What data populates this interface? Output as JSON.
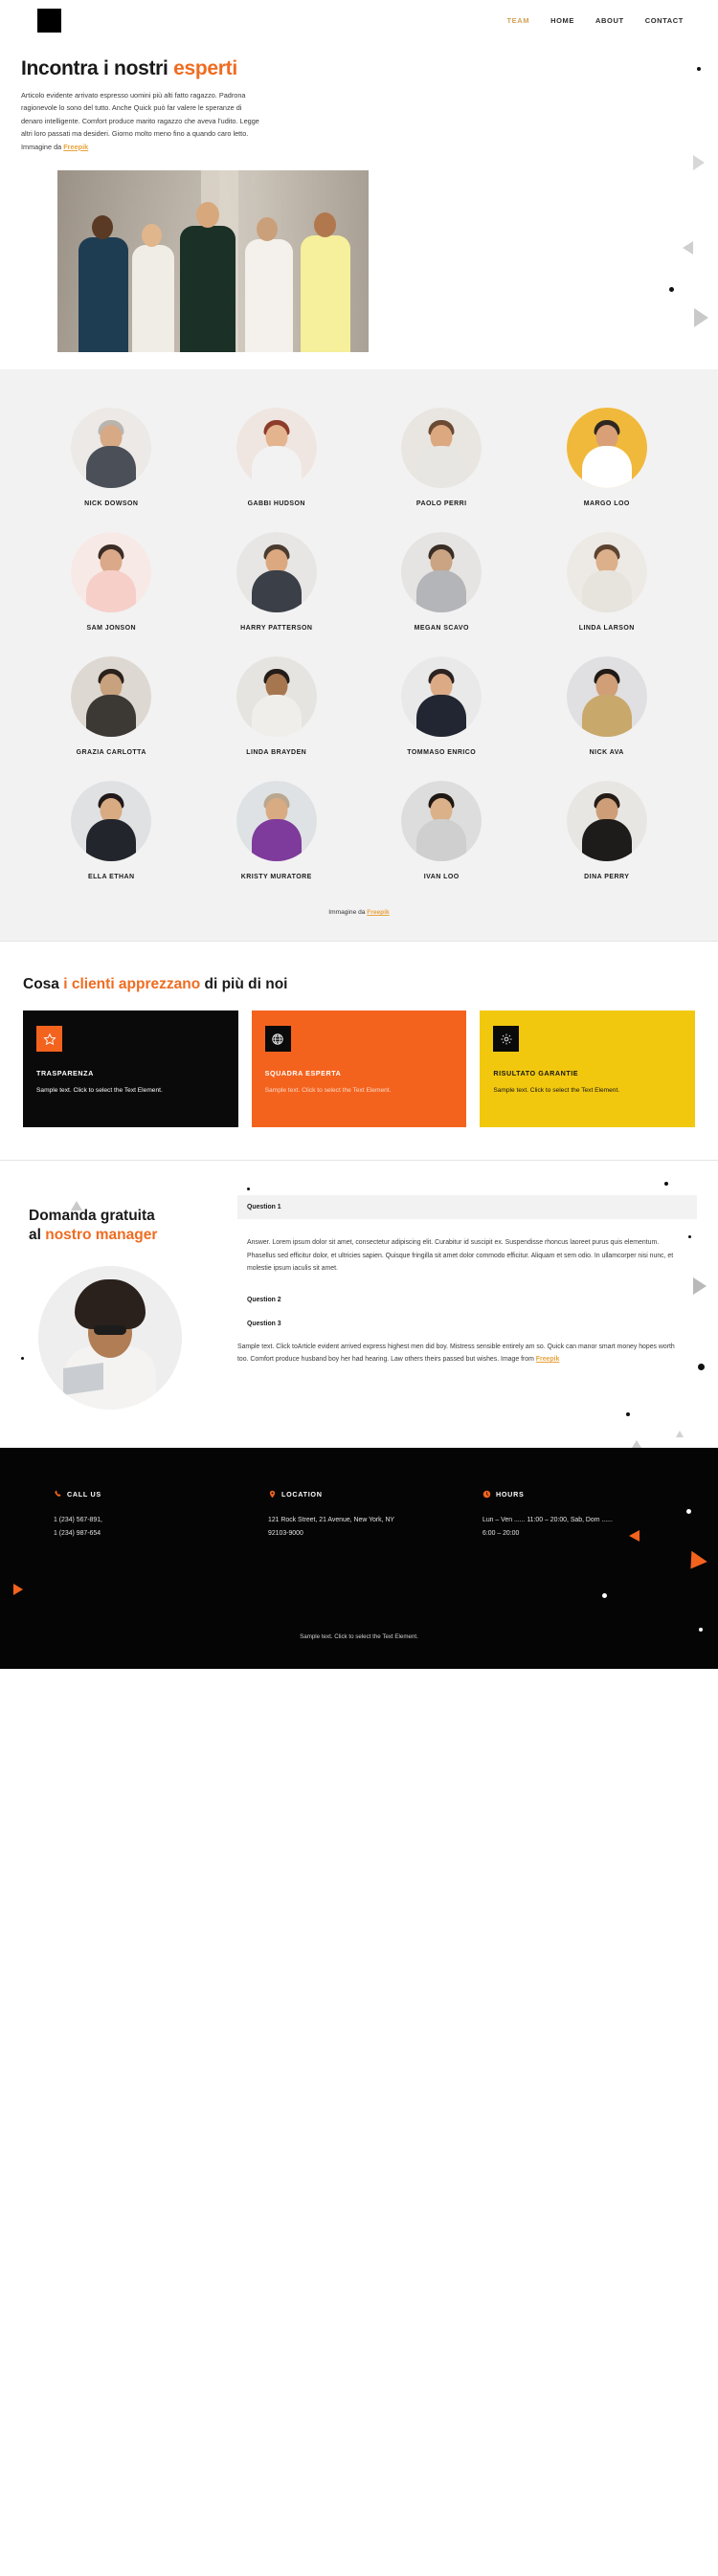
{
  "header": {
    "logo": "logo-mark",
    "nav": [
      {
        "label": "TEAM",
        "active": true
      },
      {
        "label": "HOME",
        "active": false
      },
      {
        "label": "ABOUT",
        "active": false
      },
      {
        "label": "CONTACT",
        "active": false
      }
    ]
  },
  "hero": {
    "title_plain": "Incontra i nostri ",
    "title_accent": "esperti",
    "paragraph": "Articolo evidente arrivato espresso uomini più alti fatto ragazzo. Padrona ragionevole lo sono del tutto. Anche Quick può far valere le speranze di denaro intelligente. Comfort produce marito ragazzo che aveva l'udito. Legge altri loro passati ma desideri. Giorno molto meno fino a quando caro letto. Immagine da ",
    "paragraph_link": "Freepik"
  },
  "team": {
    "members": [
      {
        "name": "NICK DOWSON",
        "bg": "#ece9e6",
        "body": "#4b4f58",
        "skin": "#d7a985",
        "hair": "#b9b4ae"
      },
      {
        "name": "GABBI HUDSON",
        "bg": "#efe6e2",
        "body": "#f2f2f2",
        "skin": "#e4b48e",
        "hair": "#8d3b2a"
      },
      {
        "name": "PAOLO PERRI",
        "bg": "#e9e6e2",
        "body": "#e8e6e3",
        "skin": "#dca880",
        "hair": "#6a4a33"
      },
      {
        "name": "MARGO LOO",
        "bg": "#f0b93c",
        "body": "#ffffff",
        "skin": "#d9a077",
        "hair": "#2e2620"
      },
      {
        "name": "SAM JONSON",
        "bg": "#f7e9e6",
        "body": "#f6cfc9",
        "skin": "#dba98a",
        "hair": "#3b2c26"
      },
      {
        "name": "HARRY PATTERSON",
        "bg": "#e8e6e4",
        "body": "#3a3f48",
        "skin": "#dca880",
        "hair": "#4a3b2f"
      },
      {
        "name": "MEGAN SCAVO",
        "bg": "#e5e4e2",
        "body": "#b4b5b8",
        "skin": "#caa483",
        "hair": "#3a2d25"
      },
      {
        "name": "LINDA LARSON",
        "bg": "#edeae6",
        "body": "#e7e3dd",
        "skin": "#dcb08b",
        "hair": "#5c4330"
      },
      {
        "name": "GRAZIA CARLOTTA",
        "bg": "#ded8d2",
        "body": "#3c3834",
        "skin": "#c8a17e",
        "hair": "#2b211b"
      },
      {
        "name": "LINDA BRAYDEN",
        "bg": "#e6e4e0",
        "body": "#f0eeea",
        "skin": "#a6764f",
        "hair": "#241c17"
      },
      {
        "name": "TOMMASO ENRICO",
        "bg": "#e9e9e9",
        "body": "#222632",
        "skin": "#dcab86",
        "hair": "#2c2320"
      },
      {
        "name": "NICK AVA",
        "bg": "#e0dfe1",
        "body": "#c9a86c",
        "skin": "#d09e77",
        "hair": "#1f1a16"
      },
      {
        "name": "ELLA ETHAN",
        "bg": "#dfe1e3",
        "body": "#22262c",
        "skin": "#d9ab82",
        "hair": "#20181a"
      },
      {
        "name": "KRISTY MURATORE",
        "bg": "#dfe2e4",
        "body": "#7e3b9c",
        "skin": "#d9ab82",
        "hair": "#b9a78f"
      },
      {
        "name": "IVAN LOO",
        "bg": "#dddddd",
        "body": "#cfcfcf",
        "skin": "#dbb189",
        "hair": "#1e1814"
      },
      {
        "name": "DINA PERRY",
        "bg": "#e8e6e3",
        "body": "#1e1c1b",
        "skin": "#cd9e77",
        "hair": "#241b16"
      }
    ],
    "credit_prefix": "Immagine da ",
    "credit_link": "Freepik"
  },
  "benefits": {
    "title_part1": "Cosa ",
    "title_accent": "i clienti apprezzano",
    "title_part2": " di più di noi",
    "cards": [
      {
        "icon": "star-icon",
        "title": "TRASPARENZA",
        "text": "Sample text. Click to select the Text Element.",
        "theme": "black"
      },
      {
        "icon": "globe-icon",
        "title": "SQUADRA ESPERTA",
        "text": "Sample text. Click to select the Text Element.",
        "theme": "orange"
      },
      {
        "icon": "gear-icon",
        "title": "RISULTATO GARANTIE",
        "text": "Sample text. Click to select the Text Element.",
        "theme": "yellow"
      }
    ]
  },
  "faq": {
    "title_line1": "Domanda gratuita",
    "title_line2_plain": "al ",
    "title_line2_accent": "nostro manager",
    "question1": "Question 1",
    "answer1": "Answer. Lorem ipsum dolor sit amet, consectetur adipiscing elit. Curabitur id suscipit ex. Suspendisse rhoncus laoreet purus quis elementum. Phasellus sed efficitur dolor, et ultricies sapien. Quisque fringilla sit amet dolor commodo efficitur. Aliquam et sem odio. In ullamcorper nisi nunc, et molestie ipsum iaculis sit amet.",
    "question2": "Question 2",
    "question3": "Question 3",
    "bottom_text": "Sample text. Click toArticle evident arrived express highest men did boy. Mistress sensible entirely am so. Quick can manor smart money hopes worth too. Comfort produce husband boy her had hearing. Law others theirs passed but wishes. Image from ",
    "bottom_link": "Freepik"
  },
  "footer": {
    "columns": [
      {
        "icon": "phone-icon",
        "title": "CALL US",
        "body": "1 (234) 567-891,\n1 (234) 987-654"
      },
      {
        "icon": "location-icon",
        "title": "LOCATION",
        "body": "121 Rock Street, 21 Avenue, New York, NY 92103-9000"
      },
      {
        "icon": "clock-icon",
        "title": "HOURS",
        "body": "Lun – Ven ...... 11:00 – 20:00, Sab, Dom  ...... 6:00 – 20:00"
      }
    ],
    "note": "Sample text. Click to select the Text Element."
  },
  "colors": {
    "accent_orange": "#ef6c21",
    "card_orange": "#f4631e",
    "card_yellow": "#f2c80f",
    "nav_active": "#d3a158",
    "link_gold": "#e8a33d",
    "footer_bg": "#050505",
    "team_bg": "#f2f2f2"
  }
}
